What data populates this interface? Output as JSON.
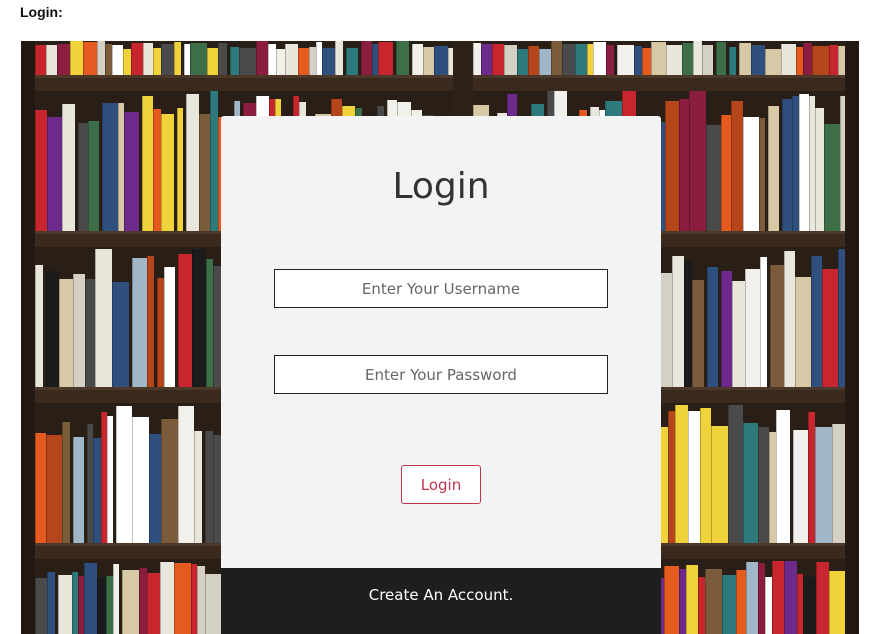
{
  "page": {
    "heading": "Login:"
  },
  "login_card": {
    "title": "Login",
    "username_placeholder": "Enter Your Username",
    "username_value": "",
    "password_placeholder": "Enter Your Password",
    "password_value": "",
    "login_button_label": "Login",
    "create_account_label": "Create An Account."
  },
  "colors": {
    "card_background": "#f3f3f3",
    "footer_background": "#1e1e1e",
    "login_button_accent": "#c0354d",
    "shelf_wood": "#2a1f17"
  },
  "background": {
    "image_subject": "bookshelf"
  }
}
